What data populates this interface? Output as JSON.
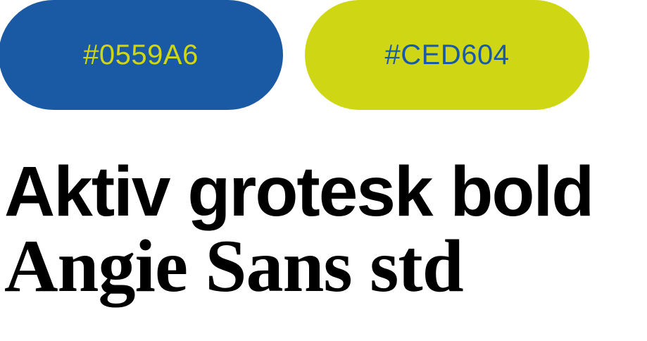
{
  "swatches": [
    {
      "label": "#0559A6",
      "background": "#1a5aa5",
      "text_color": "#cfd714"
    },
    {
      "label": "#CED604",
      "background": "#cfd714",
      "text_color": "#1a5aa5"
    }
  ],
  "fonts": [
    {
      "name": "Aktiv grotesk bold"
    },
    {
      "name": "Angie Sans std"
    }
  ]
}
